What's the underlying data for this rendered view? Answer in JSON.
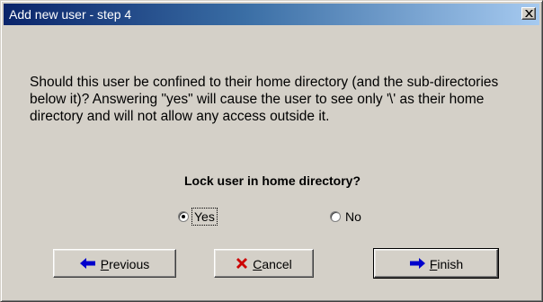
{
  "window": {
    "title": "Add new user - step 4"
  },
  "description": "Should this user be confined to their home directory (and the sub-directories below it)? Answering \"yes\" will cause the user to see only '\\' as their home directory and will not allow any access outside it.",
  "question": "Lock user in home directory?",
  "options": {
    "yes": {
      "label": "Yes",
      "selected": true
    },
    "no": {
      "label": "No",
      "selected": false
    }
  },
  "buttons": {
    "previous": {
      "label": "Previous",
      "mnemonic": "P",
      "icon": "arrow-left-icon",
      "icon_color": "#0000cc"
    },
    "cancel": {
      "label": "Cancel",
      "mnemonic": "C",
      "icon": "x-icon",
      "icon_color": "#cc0000"
    },
    "finish": {
      "label": "Finish",
      "mnemonic": "F",
      "icon": "arrow-right-icon",
      "icon_color": "#0000cc"
    }
  }
}
